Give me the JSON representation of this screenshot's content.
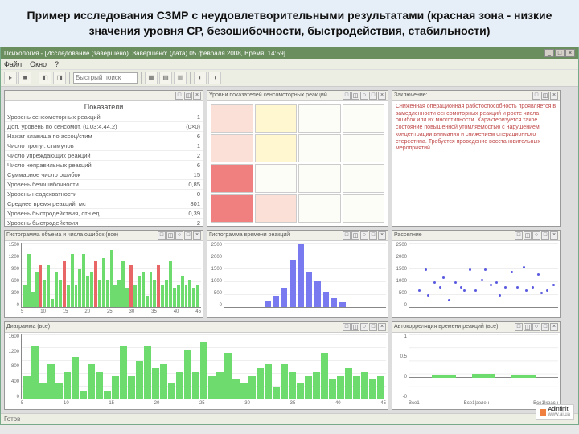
{
  "title_banner": "Пример исследования СЗМР с неудовлетворительными результатами (красная зона - низкие значения уровня СР, безошибочности, быстродействия, стабильности)",
  "window": {
    "title": "Психология - [Исследование (завершено). Завершено: (дата) 05 февраля 2008, Время: 14:59]",
    "min": "_",
    "max": "□",
    "close": "×"
  },
  "menu": {
    "file": "Файл",
    "window": "Окно",
    "help": "?"
  },
  "toolbar": {
    "search_placeholder": "Быстрый поиск"
  },
  "panels": {
    "params": {
      "title": "Показатели",
      "rows": [
        {
          "lbl": "Уровень сенсомоторных реакций",
          "val": "1"
        },
        {
          "lbl": "Доп. уровень по сенсомот. (0,03;4,44,2)",
          "val": "(0×0)"
        },
        {
          "lbl": "Нажат клавиша по ассоц/стим",
          "val": "6"
        },
        {
          "lbl": "Число пропуг.  стимулов",
          "val": "1"
        },
        {
          "lbl": "Число упреждающих реакций",
          "val": "2"
        },
        {
          "lbl": "Число неправильных реакций",
          "val": "6"
        },
        {
          "lbl": "Суммарное число ошибок",
          "val": "15"
        },
        {
          "lbl": "Уровень безошибочности",
          "val": "0,85"
        },
        {
          "lbl": "Уровень неадекватности",
          "val": "0"
        },
        {
          "lbl": "Среднее время реакций, мс",
          "val": "801"
        },
        {
          "lbl": "Уровень быстродействия, отн.ед.",
          "val": "0,39"
        },
        {
          "lbl": "Уровень быстродействия",
          "val": "2"
        }
      ]
    },
    "matrix_title": "Уровни показателей сенсомоторных реакций",
    "text": {
      "title": "Заключение:",
      "body": "Сниженная операционная работоспособность проявляется в замедленности сенсомоторных реакций и росте числа ошибок или их многотипности. Характеризуется такое состояние повышенной утомляемостью с нарушением концентрации внимания и снижением операционного стереотипа. Требуется проведение восстановительных мероприятий."
    },
    "bar1_title": "Гистограмма объема и числа ошибок (все)",
    "hist_title": "Гистограмма времени реакций",
    "scatter_title": "Рассеяние",
    "bar2_title": "Диаграмма (все)",
    "bar3_title": "Автокорреляция времени реакций (все)",
    "panel_btns": {
      "b1": "□",
      "b2": "◫",
      "b3": "○",
      "b4": "□",
      "b5": "×"
    }
  },
  "chart_data": [
    {
      "id": "bar1",
      "type": "bar",
      "ylim": [
        0,
        1700
      ],
      "yticks": [
        0,
        300,
        600,
        900,
        1200,
        1500
      ],
      "xlim": [
        0,
        50
      ],
      "xticks": [
        5,
        10,
        15,
        20,
        25,
        30,
        35,
        40,
        45
      ],
      "series": [
        {
          "name": "green",
          "color": "#6edb6e",
          "values": [
            600,
            1400,
            400,
            900,
            400,
            700,
            1100,
            200,
            900,
            700,
            200,
            600,
            1400,
            600,
            1000,
            1400,
            800,
            900,
            400,
            700,
            1300,
            700,
            1500,
            600,
            700,
            1200,
            500,
            400,
            600,
            800,
            900,
            300,
            900,
            700,
            400,
            600,
            700,
            1200,
            500,
            600,
            800,
            600,
            700,
            500,
            600
          ]
        },
        {
          "name": "red",
          "color": "#e86666",
          "values": [
            0,
            0,
            0,
            0,
            1100,
            0,
            0,
            0,
            0,
            0,
            1200,
            0,
            0,
            0,
            0,
            0,
            0,
            0,
            1200,
            0,
            0,
            0,
            0,
            0,
            0,
            0,
            0,
            1100,
            0,
            0,
            0,
            0,
            0,
            0,
            1100,
            0,
            0,
            0,
            0,
            0,
            0,
            0,
            0,
            0,
            0
          ]
        }
      ]
    },
    {
      "id": "hist",
      "type": "bar",
      "ylim": [
        0,
        3000
      ],
      "yticks": [
        0,
        500,
        1000,
        1500,
        2000,
        2500
      ],
      "categories": [
        "",
        "",
        "",
        "",
        "",
        "",
        "",
        "",
        "",
        ""
      ],
      "values": [
        300,
        500,
        900,
        2200,
        2900,
        1600,
        1200,
        700,
        400,
        200
      ]
    },
    {
      "id": "scatter",
      "type": "scatter",
      "ylim": [
        0,
        2500
      ],
      "yticks": [
        0,
        500,
        1000,
        1500,
        2000,
        2500
      ],
      "xlim": [
        0,
        50
      ],
      "points": [
        [
          3,
          600
        ],
        [
          5,
          1400
        ],
        [
          6,
          400
        ],
        [
          8,
          900
        ],
        [
          10,
          700
        ],
        [
          11,
          1100
        ],
        [
          13,
          200
        ],
        [
          15,
          900
        ],
        [
          17,
          700
        ],
        [
          18,
          600
        ],
        [
          20,
          1400
        ],
        [
          22,
          600
        ],
        [
          24,
          1000
        ],
        [
          25,
          1400
        ],
        [
          27,
          800
        ],
        [
          29,
          900
        ],
        [
          30,
          400
        ],
        [
          32,
          700
        ],
        [
          34,
          1300
        ],
        [
          36,
          700
        ],
        [
          38,
          1500
        ],
        [
          39,
          600
        ],
        [
          41,
          700
        ],
        [
          43,
          1200
        ],
        [
          44,
          500
        ],
        [
          46,
          600
        ],
        [
          48,
          800
        ]
      ]
    },
    {
      "id": "bar2",
      "type": "bar",
      "ylim": [
        0,
        1700
      ],
      "yticks": [
        0,
        400,
        800,
        1200,
        1600
      ],
      "xlim": [
        0,
        50
      ],
      "xticks": [
        5,
        10,
        15,
        20,
        25,
        30,
        35,
        40,
        45
      ],
      "values": [
        600,
        1400,
        400,
        900,
        400,
        700,
        1100,
        200,
        900,
        700,
        200,
        600,
        1400,
        600,
        1000,
        1400,
        800,
        900,
        400,
        700,
        1300,
        700,
        1500,
        600,
        700,
        1200,
        500,
        400,
        600,
        800,
        900,
        300,
        900,
        700,
        400,
        600,
        700,
        1200,
        500,
        600,
        800,
        600,
        700,
        500,
        600
      ]
    },
    {
      "id": "bar3",
      "type": "bar",
      "ylim": [
        -0.5,
        1.0
      ],
      "yticks": [
        "-0",
        "0",
        "0,5",
        "1"
      ],
      "categories": [
        "Все1",
        "Все1|зелен",
        "Все1|красн"
      ],
      "values": [
        0.05,
        0.1,
        0.08
      ]
    }
  ],
  "status": "Готов",
  "branding": {
    "name": "Adinfinit",
    "sub": "www.ai.ua"
  }
}
